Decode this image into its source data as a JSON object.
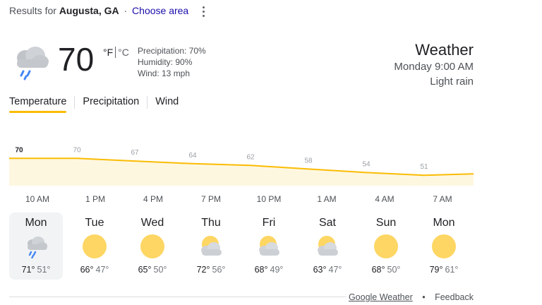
{
  "header": {
    "results_prefix": "Results for",
    "location": "Augusta, GA",
    "separator": "·",
    "choose_area": "Choose area",
    "menu_icon": "more-vert-icon"
  },
  "current": {
    "condition_icon": "cloud-rain-icon",
    "temperature": "70",
    "unit_f": "°F",
    "unit_c": "°C",
    "precipitation": "Precipitation: 70%",
    "humidity": "Humidity: 90%",
    "wind": "Wind: 13 mph"
  },
  "summary": {
    "title": "Weather",
    "datetime": "Monday 9:00 AM",
    "condition": "Light rain"
  },
  "tabs": [
    {
      "label": "Temperature",
      "active": true
    },
    {
      "label": "Precipitation",
      "active": false
    },
    {
      "label": "Wind",
      "active": false
    }
  ],
  "chart_data": {
    "type": "area",
    "values": [
      70,
      70,
      67,
      64,
      62,
      58,
      54,
      51
    ],
    "value_labels": [
      "70",
      "70",
      "67",
      "64",
      "62",
      "58",
      "54",
      "51"
    ],
    "x_labels": [
      "10 AM",
      "1 PM",
      "4 PM",
      "7 PM",
      "10 PM",
      "1 AM",
      "4 AM",
      "7 AM"
    ],
    "line_color": "#fbbc04",
    "fill_color": "#fef7e0"
  },
  "days": [
    {
      "name": "Mon",
      "hi": "71°",
      "lo": "51°",
      "icon": "rain-cloud-icon",
      "selected": true
    },
    {
      "name": "Tue",
      "hi": "66°",
      "lo": "47°",
      "icon": "sun-icon",
      "selected": false
    },
    {
      "name": "Wed",
      "hi": "65°",
      "lo": "50°",
      "icon": "sun-icon",
      "selected": false
    },
    {
      "name": "Thu",
      "hi": "72°",
      "lo": "56°",
      "icon": "partly-cloudy-icon",
      "selected": false
    },
    {
      "name": "Fri",
      "hi": "68°",
      "lo": "49°",
      "icon": "partly-cloudy-icon",
      "selected": false
    },
    {
      "name": "Sat",
      "hi": "63°",
      "lo": "47°",
      "icon": "partly-cloudy-icon",
      "selected": false
    },
    {
      "name": "Sun",
      "hi": "68°",
      "lo": "50°",
      "icon": "sun-icon",
      "selected": false
    },
    {
      "name": "Mon",
      "hi": "79°",
      "lo": "61°",
      "icon": "sun-icon",
      "selected": false
    }
  ],
  "footer": {
    "source_link": "Google Weather",
    "separator": "•",
    "feedback": "Feedback"
  },
  "colors": {
    "accent": "#fbbc04",
    "link": "#1a0dab",
    "selected_bg": "#f1f3f4"
  }
}
